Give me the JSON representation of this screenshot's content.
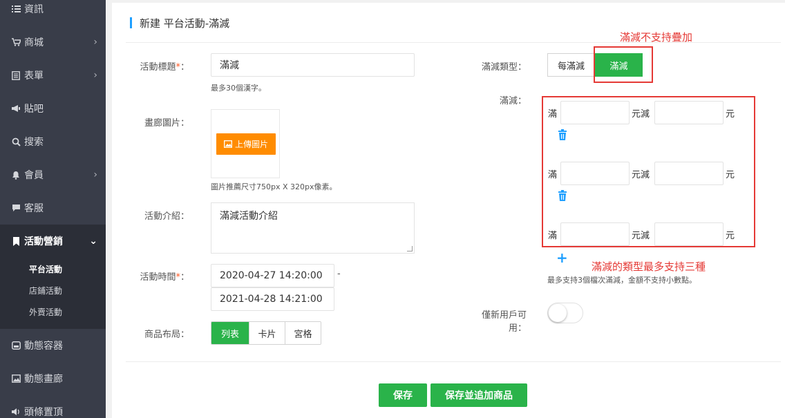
{
  "sidebar": {
    "items": [
      {
        "label": "資訊",
        "icon": "list-icon",
        "has_arrow": false
      },
      {
        "label": "商城",
        "icon": "cart-icon",
        "has_arrow": true
      },
      {
        "label": "表單",
        "icon": "form-icon",
        "has_arrow": true
      },
      {
        "label": "貼吧",
        "icon": "megaphone-icon",
        "has_arrow": false
      },
      {
        "label": "搜索",
        "icon": "search-icon",
        "has_arrow": false
      },
      {
        "label": "會員",
        "icon": "bell-icon",
        "has_arrow": true
      },
      {
        "label": "客服",
        "icon": "chat-icon",
        "has_arrow": false
      },
      {
        "label": "活動營銷",
        "icon": "bookmark-icon",
        "has_arrow": true,
        "expanded": true
      },
      {
        "label": "動態容器",
        "icon": "container-icon",
        "has_arrow": false
      },
      {
        "label": "動態畫廊",
        "icon": "image-icon",
        "has_arrow": false
      },
      {
        "label": "頭條置頂",
        "icon": "speaker-icon",
        "has_arrow": false
      }
    ],
    "subitems": [
      {
        "label": "平台活動",
        "current": true
      },
      {
        "label": "店鋪活動",
        "current": false
      },
      {
        "label": "外賣活動",
        "current": false
      }
    ]
  },
  "page": {
    "title": "新建 平台活動-滿減"
  },
  "form": {
    "title_label": "活動標題",
    "required_mark": "*",
    "colon": "：",
    "title_value": "滿減",
    "title_hint": "最多30個漢字。",
    "gallery_label": "畫廊圖片",
    "upload_button": "上傳圖片",
    "image_hint": "圖片推薦尺寸750px X 320px像素。",
    "intro_label": "活動介紹",
    "intro_value": "滿減活動介紹",
    "time_label": "活動時間",
    "start_time": "2020-04-27 14:20:00",
    "time_separator": "-",
    "end_time": "2021-04-28 14:21:00",
    "layout_label": "商品布局",
    "layout_options": [
      "列表",
      "卡片",
      "宮格"
    ],
    "layout_selected": "列表",
    "type_label": "滿減類型",
    "type_options": [
      "每滿減",
      "滿減"
    ],
    "type_selected": "滿減",
    "tiers_label": "滿減",
    "tier_prefix": "滿",
    "tier_middle": "元減",
    "tier_suffix": "元",
    "tiers": [
      {
        "full": "",
        "minus": "",
        "deletable": true
      },
      {
        "full": "",
        "minus": "",
        "deletable": true
      },
      {
        "full": "",
        "minus": "",
        "deletable": false
      }
    ],
    "tiers_hint": "最多支持3個檔次滿減，金額不支持小數點。",
    "new_user_label_1": "僅新用戶可",
    "new_user_label_2": "用：",
    "new_user_enabled": false
  },
  "annotations": {
    "no_stack_note": "滿減不支持疊加",
    "max_three_note": "滿減的類型最多支持三種",
    "color": "#e53935"
  },
  "actions": {
    "save": "保存",
    "save_and_add": "保存並追加商品"
  },
  "colors": {
    "sidebar_bg": "#393d49",
    "primary_green": "#2ab34a",
    "upload_orange": "#ff8c00",
    "accent_blue": "#1e9fff"
  }
}
